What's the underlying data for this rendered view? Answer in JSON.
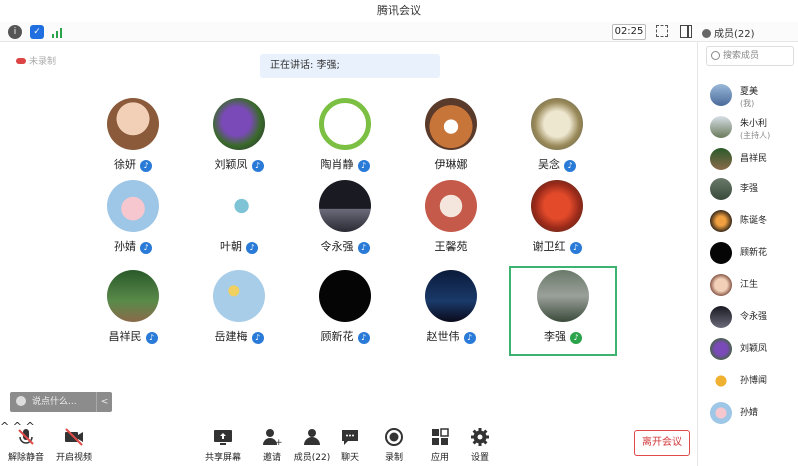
{
  "window": {
    "title": "腾讯会议"
  },
  "topbar": {
    "timer": "02:25",
    "members_label": "成员(22)"
  },
  "main": {
    "cloud_record": "未录制",
    "speaking_label": "正在讲话: 李强;",
    "chat_placeholder": "说点什么...",
    "chat_collapse": "<"
  },
  "participants": [
    {
      "name": "徐妍",
      "mic": "blue"
    },
    {
      "name": "刘颖凤",
      "mic": "blue"
    },
    {
      "name": "陶肖静",
      "mic": "blue"
    },
    {
      "name": "伊琳娜",
      "mic": "none"
    },
    {
      "name": "吴念",
      "mic": "blue"
    },
    {
      "name": "孙婧",
      "mic": "blue"
    },
    {
      "name": "叶朝",
      "mic": "blue"
    },
    {
      "name": "令永强",
      "mic": "blue"
    },
    {
      "name": "王馨苑",
      "mic": "none"
    },
    {
      "name": "谢卫红",
      "mic": "blue"
    },
    {
      "name": "昌祥民",
      "mic": "blue"
    },
    {
      "name": "岳建梅",
      "mic": "blue"
    },
    {
      "name": "顾新花",
      "mic": "blue"
    },
    {
      "name": "赵世伟",
      "mic": "blue"
    },
    {
      "name": "李强",
      "mic": "green",
      "active": true
    }
  ],
  "toolbar": {
    "unmute": "解除静音",
    "video": "开启视频",
    "share": "共享屏幕",
    "invite": "邀请",
    "members": "成员(22)",
    "chat": "聊天",
    "record": "录制",
    "apps": "应用",
    "settings": "设置",
    "leave": "离开会议",
    "caret": "^"
  },
  "sidebar": {
    "search_placeholder": "搜索成员",
    "members": [
      {
        "name": "夏美",
        "role": "(我)"
      },
      {
        "name": "朱小利",
        "role": "(主持人)"
      },
      {
        "name": "昌祥民",
        "role": ""
      },
      {
        "name": "李强",
        "role": ""
      },
      {
        "name": "陈诞冬",
        "role": ""
      },
      {
        "name": "顾新花",
        "role": ""
      },
      {
        "name": "江生",
        "role": ""
      },
      {
        "name": "令永强",
        "role": ""
      },
      {
        "name": "刘颖凤",
        "role": ""
      },
      {
        "name": "孙博闻",
        "role": ""
      },
      {
        "name": "孙婧",
        "role": ""
      }
    ]
  },
  "colors": {
    "accent": "#2a7ad8",
    "active_border": "#3cb371",
    "leave": "#d23a3a"
  }
}
